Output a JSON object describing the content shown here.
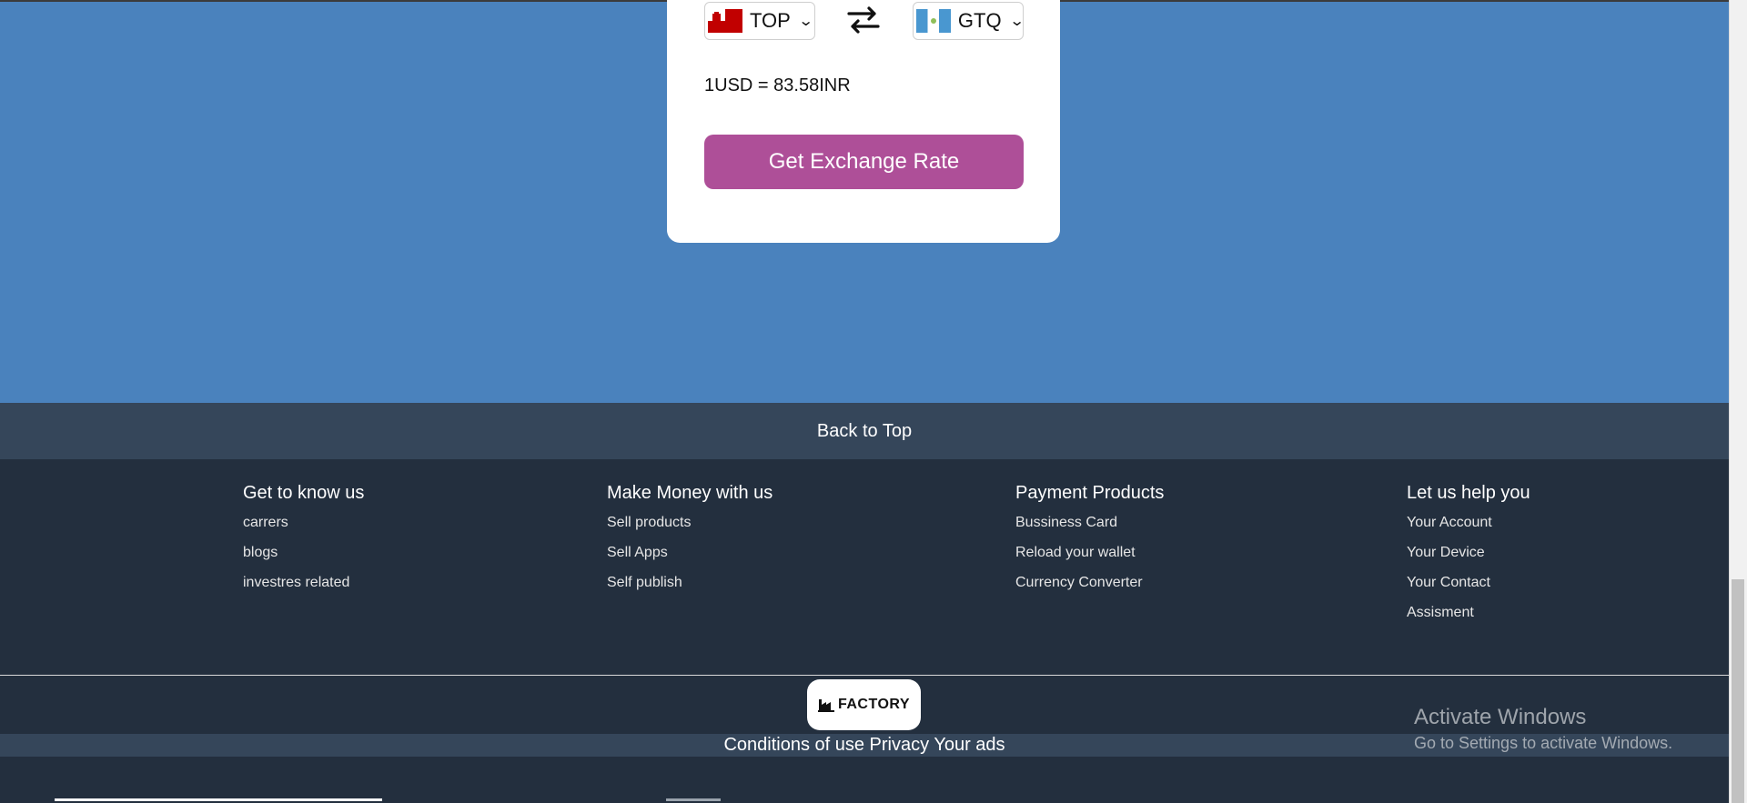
{
  "converter": {
    "from": {
      "code": "TOP",
      "flag": "tonga-flag"
    },
    "to": {
      "code": "GTQ",
      "flag": "guatemala-flag"
    },
    "rate_text": "1USD = 83.58INR",
    "button_label": "Get Exchange Rate"
  },
  "back_to_top": "Back to Top",
  "footer": {
    "columns": [
      {
        "title": "Get to know us",
        "links": [
          "carrers",
          "blogs",
          "investres related"
        ]
      },
      {
        "title": "Make Money with us",
        "links": [
          "Sell products",
          "Sell Apps",
          "Self publish"
        ]
      },
      {
        "title": "Payment Products",
        "links": [
          "Bussiness Card",
          "Reload your wallet",
          "Currency Converter"
        ]
      },
      {
        "title": "Let us help you",
        "links": [
          "Your Account",
          "Your Device",
          "Your Contact",
          "Assisment"
        ]
      }
    ],
    "logo_text": "FACTORY",
    "conditions": "Conditions of use Privacy Your ads"
  },
  "watermark": {
    "title": "Activate Windows",
    "subtitle": "Go to Settings to activate Windows."
  },
  "colors": {
    "background": "#4a82bd",
    "button": "#ae4f98",
    "footer": "#232f3e",
    "back_to_top": "#35465a"
  }
}
